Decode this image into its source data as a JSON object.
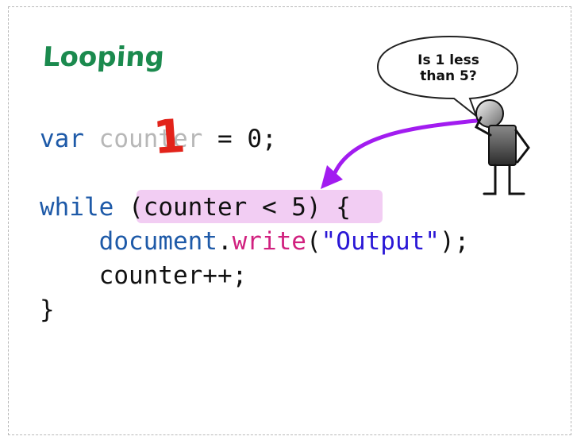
{
  "slide": {
    "title": "Looping",
    "callout": {
      "line1": "Is 1 less",
      "line2": "than 5?"
    },
    "annotation_value": "1",
    "code": {
      "line1": {
        "kw": "var",
        "name": "counter",
        "rest": " = 0;"
      },
      "line2": {
        "kw": "while",
        "space": " ",
        "condition": "(counter < 5)",
        "rest": " {"
      },
      "line3": {
        "indent": "    ",
        "obj": "document",
        "dot": ".",
        "method": "write",
        "open": "(",
        "str": "\"Output\"",
        "close": ");"
      },
      "line4": {
        "indent": "    ",
        "text": "counter++;"
      },
      "line5": {
        "text": "}"
      }
    },
    "colors": {
      "title": "#1b8a4e",
      "keyword": "#1e5aa8",
      "method": "#d1217f",
      "string": "#2a17d6",
      "faded": "#b7b7b7",
      "highlight": "#f1c8f2",
      "arrow": "#a21cf0",
      "scribble": "#e2231a"
    },
    "icons": [
      "speech-bubble",
      "thinking-stick-figure",
      "curved-arrow"
    ]
  }
}
